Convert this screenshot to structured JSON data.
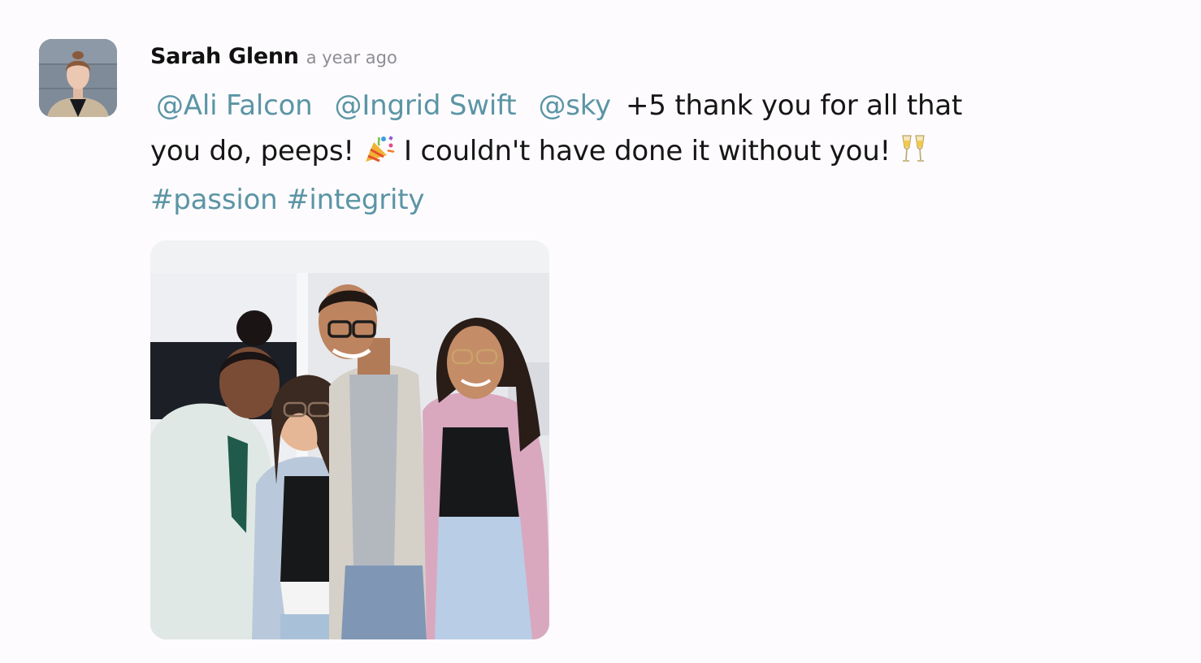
{
  "post": {
    "author": {
      "name": "Sarah Glenn",
      "avatar_icon": "profile-photo"
    },
    "timestamp": "a year ago",
    "mentions": [
      {
        "label": "@Ali Falcon"
      },
      {
        "label": "@Ingrid Swift"
      },
      {
        "label": "@sky"
      }
    ],
    "more_count": "+5",
    "text_part1": "thank you for all that you do, peeps! ",
    "emoji_party": "party-popper-icon",
    "text_part2": " I couldn't have done it without you! ",
    "emoji_cheers": "clinking-glasses-icon",
    "hashtags": [
      {
        "label": "#passion"
      },
      {
        "label": "#integrity"
      }
    ],
    "image": {
      "subject": "group-photo",
      "alt": ""
    }
  },
  "colors": {
    "background": "#fdfbfd",
    "link": "#5b95a5",
    "text": "#161616",
    "muted": "#8d8d93"
  }
}
